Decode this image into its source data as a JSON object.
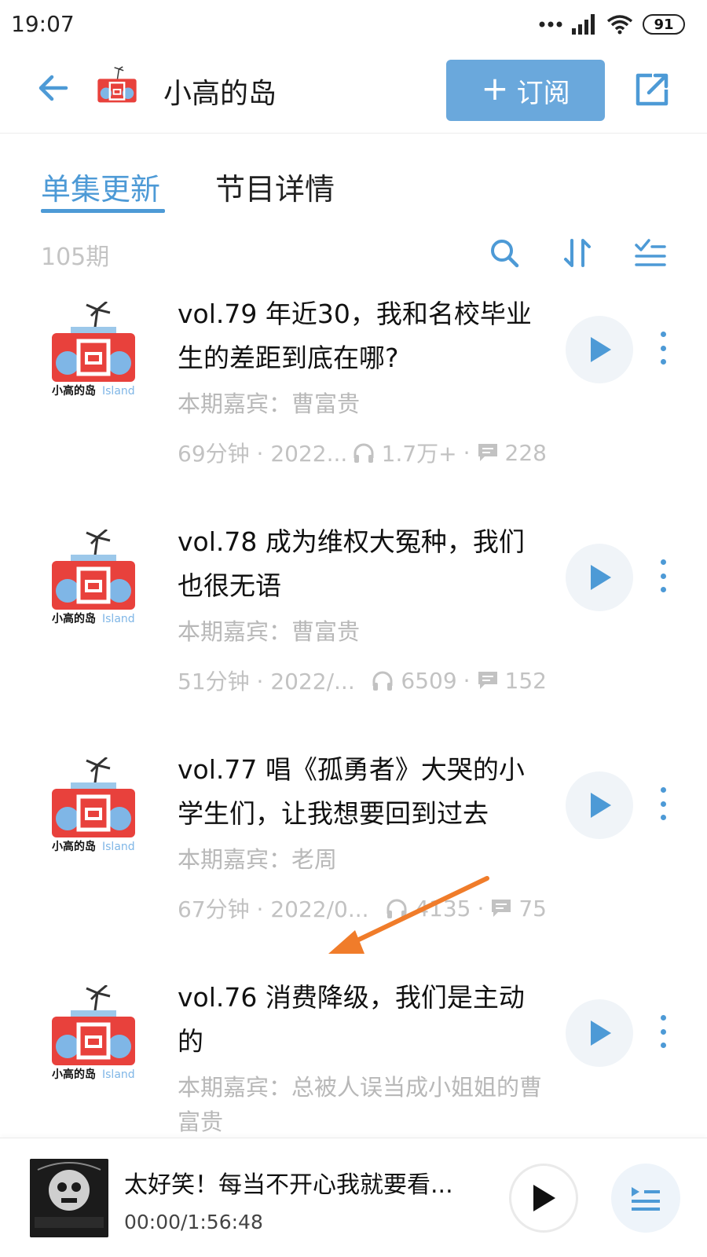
{
  "status_bar": {
    "time": "19:07",
    "battery": "91"
  },
  "header": {
    "title": "小高的岛",
    "subscribe_label": "订阅",
    "logo_text": "小高的岛"
  },
  "tabs": [
    {
      "label": "单集更新",
      "active": true
    },
    {
      "label": "节目详情",
      "active": false
    }
  ],
  "toolbar": {
    "episode_count": "105期"
  },
  "episodes": [
    {
      "title": "vol.79 年近30，我和名校毕业生的差距到底在哪?",
      "guest": "本期嘉宾：曹富贵",
      "duration": "69分钟 · 2022...",
      "plays": "1.7万+",
      "comments": "228"
    },
    {
      "title": "vol.78 成为维权大冤种，我们也很无语",
      "guest": "本期嘉宾：曹富贵",
      "duration": "51分钟 · 2022/...",
      "plays": "6509",
      "comments": "152"
    },
    {
      "title": "vol.77 唱《孤勇者》大哭的小学生们，让我想要回到过去",
      "guest": "本期嘉宾：老周",
      "duration": "67分钟 · 2022/0...",
      "plays": "4135",
      "comments": "75"
    },
    {
      "title": "vol.76 消费降级，我们是主动的",
      "guest": "本期嘉宾：总被人误当成小姐姐的曹富贵",
      "duration": "",
      "plays": "",
      "comments": ""
    }
  ],
  "mini_player": {
    "title": "太好笑！每当不开心我就要看...",
    "time": "00:00/1:56:48"
  },
  "colors": {
    "accent": "#4d9ad6",
    "subscribe_bg": "#6aa8dc",
    "annotation": "#f07c2a",
    "cover_red": "#e8413c",
    "cover_blue": "#7fb6e6"
  }
}
